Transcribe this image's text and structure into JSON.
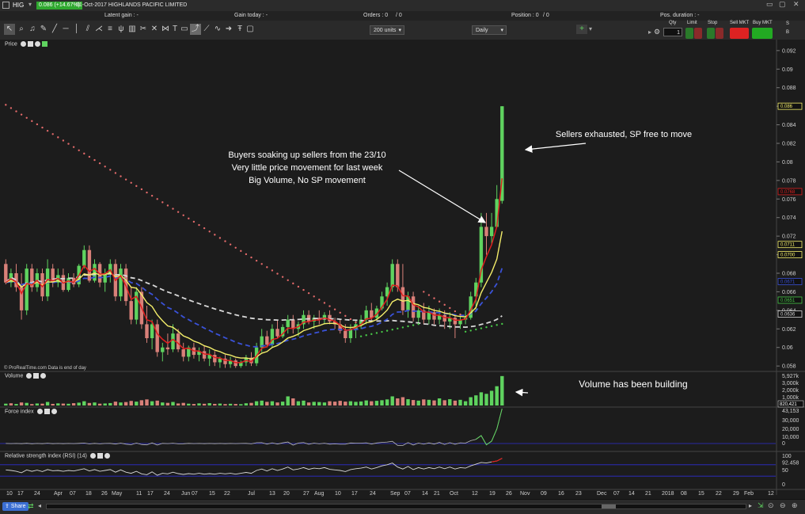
{
  "header": {
    "symbol": "HIG",
    "price_change": "0.086 (+14.67%)",
    "date_title": "31-Oct-2017  HIGHLANDS PACIFIC LIMITED"
  },
  "info": {
    "latent_gain": "Latent gain : -",
    "gain_today": "Gain today : -",
    "orders": "Orders : 0",
    "orders_count": "/ 0",
    "position": "Position : 0",
    "position_count": "/ 0",
    "pos_duration": "Pos. duration : -"
  },
  "toolbar": {
    "units_select": "200 units",
    "period_select": "Daily",
    "qty_label": "Qty",
    "qty_value": "1",
    "limit_label": "Limit",
    "stop_label": "Stop",
    "sell_label": "Sell MKT",
    "buy_label": "Buy MKT",
    "side_s": "S",
    "side_b": "B"
  },
  "panels": {
    "price": "Price",
    "volume": "Volume",
    "force": "Force index",
    "rsi": "Relative strength index (RSI) (14)",
    "credit": "© ProRealTime.com  Data is end of day"
  },
  "annotations": {
    "buyers": [
      "Buyers soaking up sellers from the 23/10",
      "Very little price movement for last week",
      "Big Volume, No SP movement"
    ],
    "sellers": "Sellers exhausted, SP free to move",
    "volume": "Volume has been building"
  },
  "colors": {
    "bull": "#5fd35f",
    "bear": "#d98079",
    "ma_fast": "#e02020",
    "ma_mid": "#f4ee6a",
    "ma_slow": "#3a52d8",
    "ma_long": "#d8d8d8",
    "sar": "#e36a6a",
    "sar_up": "#48c848"
  },
  "chart_data": {
    "type": "candlestick",
    "price_axis": {
      "ylim": [
        0.0575,
        0.0925
      ],
      "ticks": [
        "0.092",
        "0.09",
        "0.088",
        "0.086",
        "0.084",
        "0.082",
        "0.08",
        "0.078",
        "0.076",
        "0.074",
        "0.072",
        "0.07",
        "0.068",
        "0.066",
        "0.064",
        "0.062",
        "0.06",
        "0.058"
      ],
      "badges": [
        {
          "text": "0.086",
          "value": 0.086,
          "color": "#f4ee6a"
        },
        {
          "text": "0.0768",
          "value": 0.0768,
          "color": "#e02020"
        },
        {
          "text": "0.0711",
          "value": 0.0711,
          "color": "#f4ee6a"
        },
        {
          "text": "0.0700",
          "value": 0.07,
          "color": "#f4ee6a"
        },
        {
          "text": "0.0671",
          "value": 0.0671,
          "color": "#3a52d8"
        },
        {
          "text": "0.0651",
          "value": 0.0651,
          "color": "#48c848"
        },
        {
          "text": "0.0636",
          "value": 0.0636,
          "color": "#d8d8d8"
        }
      ]
    },
    "volume_axis": {
      "ticks": [
        "5,927k",
        "3,000k",
        "2,000k",
        "1,000k"
      ],
      "badge": "820,421"
    },
    "force_axis": {
      "ticks": [
        "43,153",
        "30,000",
        "20,000",
        "10,000",
        "0"
      ]
    },
    "rsi_axis": {
      "ticks": [
        "100",
        "92.458",
        "50",
        "0"
      ]
    },
    "x_labels": [
      "10",
      "17",
      "24",
      "Apr",
      "07",
      "18",
      "26",
      "May",
      "11",
      "17",
      "24",
      "Jun",
      "07",
      "15",
      "22",
      "Jul",
      "13",
      "20",
      "27",
      "Aug",
      "10",
      "17",
      "24",
      "Sep",
      "07",
      "14",
      "21",
      "Oct",
      "12",
      "19",
      "26",
      "Nov",
      "09",
      "16",
      "23",
      "Dec",
      "07",
      "14",
      "21",
      "2018",
      "08",
      "15",
      "22",
      "29",
      "Feb",
      "12"
    ],
    "candles": [
      [
        0.069,
        0.0695,
        0.0668,
        0.067
      ],
      [
        0.067,
        0.0685,
        0.0665,
        0.068
      ],
      [
        0.068,
        0.069,
        0.066,
        0.0665
      ],
      [
        0.0665,
        0.068,
        0.063,
        0.064
      ],
      [
        0.064,
        0.069,
        0.0635,
        0.0685
      ],
      [
        0.0685,
        0.069,
        0.066,
        0.0665
      ],
      [
        0.0665,
        0.0685,
        0.066,
        0.068
      ],
      [
        0.068,
        0.0685,
        0.065,
        0.0655
      ],
      [
        0.0655,
        0.0695,
        0.065,
        0.0685
      ],
      [
        0.0685,
        0.069,
        0.0665,
        0.067
      ],
      [
        0.067,
        0.0685,
        0.0665,
        0.0678
      ],
      [
        0.0678,
        0.0685,
        0.066,
        0.0662
      ],
      [
        0.0662,
        0.068,
        0.066,
        0.0675
      ],
      [
        0.0675,
        0.068,
        0.0665,
        0.0668
      ],
      [
        0.0668,
        0.069,
        0.0665,
        0.0688
      ],
      [
        0.0688,
        0.071,
        0.0685,
        0.0705
      ],
      [
        0.0705,
        0.071,
        0.067,
        0.0672
      ],
      [
        0.0672,
        0.0695,
        0.067,
        0.069
      ],
      [
        0.069,
        0.0692,
        0.0665,
        0.067
      ],
      [
        0.067,
        0.0685,
        0.066,
        0.068
      ],
      [
        0.068,
        0.0695,
        0.067,
        0.069
      ],
      [
        0.069,
        0.0695,
        0.065,
        0.0655
      ],
      [
        0.0655,
        0.069,
        0.065,
        0.0685
      ],
      [
        0.0685,
        0.069,
        0.0645,
        0.065
      ],
      [
        0.065,
        0.0665,
        0.0625,
        0.063
      ],
      [
        0.063,
        0.0665,
        0.0625,
        0.066
      ],
      [
        0.066,
        0.0665,
        0.062,
        0.0625
      ],
      [
        0.0625,
        0.0645,
        0.0605,
        0.061
      ],
      [
        0.061,
        0.063,
        0.0598,
        0.0625
      ],
      [
        0.0625,
        0.063,
        0.059,
        0.0595
      ],
      [
        0.0595,
        0.0605,
        0.0585,
        0.06
      ],
      [
        0.06,
        0.0615,
        0.0592,
        0.0598
      ],
      [
        0.0598,
        0.0625,
        0.0595,
        0.0615
      ],
      [
        0.0615,
        0.062,
        0.0595,
        0.0598
      ],
      [
        0.0598,
        0.0605,
        0.0585,
        0.059
      ],
      [
        0.059,
        0.0602,
        0.0585,
        0.06
      ],
      [
        0.06,
        0.0605,
        0.0588,
        0.0592
      ],
      [
        0.0592,
        0.06,
        0.0585,
        0.0596
      ],
      [
        0.0596,
        0.0602,
        0.0585,
        0.0588
      ],
      [
        0.0588,
        0.0598,
        0.058,
        0.0592
      ],
      [
        0.0592,
        0.0596,
        0.058,
        0.0584
      ],
      [
        0.0584,
        0.059,
        0.0578,
        0.0588
      ],
      [
        0.0588,
        0.0592,
        0.0578,
        0.0582
      ],
      [
        0.0582,
        0.059,
        0.0578,
        0.0586
      ],
      [
        0.0586,
        0.0588,
        0.0578,
        0.058
      ],
      [
        0.058,
        0.0586,
        0.0578,
        0.0584
      ],
      [
        0.0584,
        0.0592,
        0.058,
        0.0589
      ],
      [
        0.0589,
        0.0595,
        0.058,
        0.0583
      ],
      [
        0.0583,
        0.0605,
        0.058,
        0.06
      ],
      [
        0.06,
        0.062,
        0.0595,
        0.0612
      ],
      [
        0.0612,
        0.0618,
        0.06,
        0.0603
      ],
      [
        0.0603,
        0.0625,
        0.06,
        0.062
      ],
      [
        0.062,
        0.063,
        0.061,
        0.0612
      ],
      [
        0.0612,
        0.0625,
        0.061,
        0.0622
      ],
      [
        0.0622,
        0.0635,
        0.0615,
        0.063
      ],
      [
        0.063,
        0.0635,
        0.0615,
        0.062
      ],
      [
        0.062,
        0.0628,
        0.0612,
        0.0625
      ],
      [
        0.0625,
        0.064,
        0.062,
        0.0635
      ],
      [
        0.0635,
        0.064,
        0.0625,
        0.0628
      ],
      [
        0.0628,
        0.0635,
        0.062,
        0.0632
      ],
      [
        0.0632,
        0.064,
        0.0625,
        0.063
      ],
      [
        0.063,
        0.0638,
        0.0625,
        0.0635
      ],
      [
        0.0635,
        0.064,
        0.0625,
        0.0628
      ],
      [
        0.0628,
        0.0632,
        0.062,
        0.0625
      ],
      [
        0.0625,
        0.063,
        0.0615,
        0.0618
      ],
      [
        0.0618,
        0.0625,
        0.0605,
        0.061
      ],
      [
        0.061,
        0.0625,
        0.0605,
        0.062
      ],
      [
        0.062,
        0.063,
        0.061,
        0.0625
      ],
      [
        0.0625,
        0.0635,
        0.062,
        0.063
      ],
      [
        0.063,
        0.0645,
        0.0625,
        0.064
      ],
      [
        0.064,
        0.0648,
        0.0628,
        0.0632
      ],
      [
        0.0632,
        0.0645,
        0.063,
        0.0642
      ],
      [
        0.0642,
        0.066,
        0.064,
        0.0655
      ],
      [
        0.0655,
        0.067,
        0.0645,
        0.0665
      ],
      [
        0.0665,
        0.0695,
        0.066,
        0.069
      ],
      [
        0.069,
        0.0695,
        0.066,
        0.0665
      ],
      [
        0.0665,
        0.069,
        0.0635,
        0.064
      ],
      [
        0.064,
        0.066,
        0.0632,
        0.0655
      ],
      [
        0.0655,
        0.066,
        0.0628,
        0.0632
      ],
      [
        0.0632,
        0.0645,
        0.0625,
        0.064
      ],
      [
        0.064,
        0.0648,
        0.0625,
        0.063
      ],
      [
        0.063,
        0.0645,
        0.0625,
        0.0638
      ],
      [
        0.0638,
        0.0642,
        0.0625,
        0.063
      ],
      [
        0.063,
        0.0642,
        0.0625,
        0.0635
      ],
      [
        0.0635,
        0.064,
        0.062,
        0.0628
      ],
      [
        0.0628,
        0.0638,
        0.062,
        0.0632
      ],
      [
        0.0632,
        0.0635,
        0.061,
        0.0625
      ],
      [
        0.0625,
        0.0635,
        0.062,
        0.063
      ],
      [
        0.063,
        0.064,
        0.0625,
        0.0632
      ],
      [
        0.0632,
        0.066,
        0.063,
        0.0655
      ],
      [
        0.0655,
        0.0675,
        0.064,
        0.067
      ],
      [
        0.067,
        0.0745,
        0.0665,
        0.073
      ],
      [
        0.073,
        0.0745,
        0.07,
        0.072
      ],
      [
        0.072,
        0.0745,
        0.0712,
        0.073
      ],
      [
        0.073,
        0.0775,
        0.0755,
        0.076
      ],
      [
        0.0758,
        0.086,
        0.0755,
        0.086
      ]
    ],
    "volume": [
      [
        180,
        1
      ],
      [
        220,
        0
      ],
      [
        150,
        1
      ],
      [
        300,
        0
      ],
      [
        260,
        1
      ],
      [
        140,
        0
      ],
      [
        200,
        1
      ],
      [
        180,
        0
      ],
      [
        350,
        1
      ],
      [
        160,
        0
      ],
      [
        210,
        1
      ],
      [
        190,
        0
      ],
      [
        170,
        1
      ],
      [
        230,
        0
      ],
      [
        280,
        1
      ],
      [
        420,
        1
      ],
      [
        250,
        0
      ],
      [
        300,
        1
      ],
      [
        180,
        0
      ],
      [
        200,
        1
      ],
      [
        240,
        1
      ],
      [
        380,
        0
      ],
      [
        300,
        1
      ],
      [
        340,
        0
      ],
      [
        450,
        0
      ],
      [
        380,
        1
      ],
      [
        520,
        0
      ],
      [
        600,
        0
      ],
      [
        420,
        1
      ],
      [
        480,
        0
      ],
      [
        300,
        1
      ],
      [
        260,
        0
      ],
      [
        350,
        1
      ],
      [
        200,
        0
      ],
      [
        260,
        0
      ],
      [
        180,
        1
      ],
      [
        150,
        0
      ],
      [
        210,
        1
      ],
      [
        170,
        0
      ],
      [
        230,
        1
      ],
      [
        160,
        0
      ],
      [
        190,
        1
      ],
      [
        140,
        0
      ],
      [
        170,
        1
      ],
      [
        150,
        0
      ],
      [
        130,
        1
      ],
      [
        220,
        1
      ],
      [
        260,
        0
      ],
      [
        420,
        1
      ],
      [
        480,
        1
      ],
      [
        360,
        0
      ],
      [
        420,
        1
      ],
      [
        300,
        0
      ],
      [
        380,
        1
      ],
      [
        900,
        1
      ],
      [
        700,
        0
      ],
      [
        420,
        1
      ],
      [
        480,
        1
      ],
      [
        300,
        0
      ],
      [
        360,
        1
      ],
      [
        340,
        1
      ],
      [
        300,
        1
      ],
      [
        420,
        0
      ],
      [
        380,
        0
      ],
      [
        460,
        0
      ],
      [
        380,
        0
      ],
      [
        420,
        1
      ],
      [
        360,
        1
      ],
      [
        400,
        1
      ],
      [
        500,
        1
      ],
      [
        420,
        0
      ],
      [
        460,
        1
      ],
      [
        520,
        1
      ],
      [
        600,
        1
      ],
      [
        900,
        1
      ],
      [
        700,
        0
      ],
      [
        820,
        0
      ],
      [
        620,
        1
      ],
      [
        540,
        0
      ],
      [
        480,
        1
      ],
      [
        600,
        0
      ],
      [
        560,
        1
      ],
      [
        500,
        0
      ],
      [
        700,
        1
      ],
      [
        520,
        0
      ],
      [
        620,
        1
      ],
      [
        480,
        0
      ],
      [
        560,
        1
      ],
      [
        420,
        1
      ],
      [
        820,
        1
      ],
      [
        1000,
        1
      ],
      [
        1300,
        1
      ],
      [
        1150,
        1
      ],
      [
        1450,
        1
      ],
      [
        1900,
        1
      ],
      [
        2900,
        1
      ]
    ],
    "force_index": [
      120,
      -60,
      80,
      -140,
      300,
      -200,
      140,
      -160,
      380,
      -120,
      100,
      -120,
      90,
      -80,
      220,
      600,
      -400,
      240,
      -300,
      120,
      180,
      -560,
      480,
      -600,
      -1100,
      620,
      -900,
      -1300,
      800,
      -1400,
      180,
      -90,
      420,
      -300,
      -220,
      160,
      -110,
      120,
      -160,
      140,
      -120,
      110,
      -150,
      90,
      -110,
      80,
      240,
      -300,
      950,
      1100,
      -600,
      880,
      -520,
      760,
      1900,
      -1500,
      620,
      1200,
      -700,
      500,
      -300,
      420,
      -600,
      -380,
      -700,
      -650,
      700,
      450,
      520,
      900,
      -500,
      700,
      1400,
      1900,
      2700,
      -1700,
      -1900,
      1200,
      -1400,
      600,
      -700,
      800,
      -600,
      1400,
      -900,
      1100,
      -700,
      900,
      500,
      3500,
      5200,
      9800,
      -1200,
      2900,
      18000,
      43153
    ],
    "rsi": [
      52,
      50,
      47,
      42,
      52,
      47,
      51,
      46,
      53,
      49,
      50,
      47,
      50,
      48,
      52,
      56,
      48,
      53,
      47,
      50,
      53,
      44,
      52,
      44,
      40,
      47,
      38,
      35,
      45,
      33,
      40,
      38,
      44,
      39,
      36,
      39,
      37,
      40,
      37,
      39,
      37,
      40,
      38,
      40,
      37,
      40,
      43,
      40,
      50,
      55,
      48,
      56,
      50,
      55,
      62,
      52,
      55,
      60,
      54,
      58,
      56,
      60,
      54,
      52,
      50,
      46,
      53,
      56,
      58,
      62,
      55,
      60,
      66,
      70,
      76,
      62,
      55,
      64,
      53,
      60,
      55,
      60,
      56,
      62,
      56,
      62,
      55,
      60,
      58,
      66,
      72,
      78,
      76,
      80,
      83,
      92.458
    ]
  },
  "bottom": {
    "share_label": "Share"
  }
}
